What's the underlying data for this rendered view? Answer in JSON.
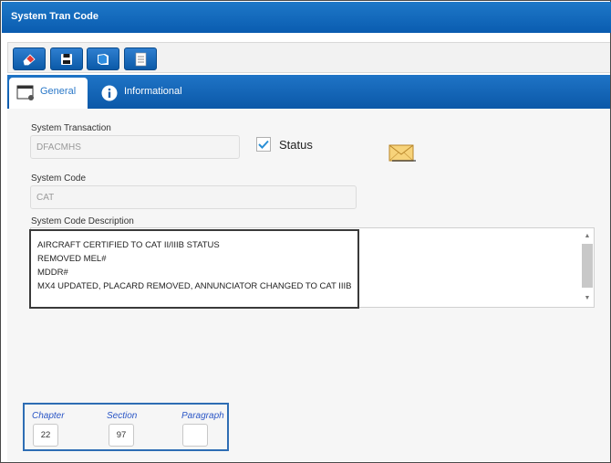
{
  "window": {
    "title": "System Tran Code"
  },
  "toolbar": {
    "buttons": [
      {
        "icon": "eraser-icon"
      },
      {
        "icon": "save-icon"
      },
      {
        "icon": "book-icon"
      },
      {
        "icon": "document-icon"
      }
    ]
  },
  "tabs": [
    {
      "label": "General",
      "icon": "window-icon",
      "active": true
    },
    {
      "label": "Informational",
      "icon": "info-icon",
      "active": false
    }
  ],
  "form": {
    "system_transaction_label": "System Transaction",
    "system_transaction_value": "DFACMHS",
    "status_label": "Status",
    "status_checked": true,
    "system_code_label": "System Code",
    "system_code_value": "CAT",
    "description_label": "System Code Description",
    "description_value": "AIRCRAFT CERTIFIED TO CAT II/IIIB STATUS\nREMOVED MEL#\nMDDR#\nMX4 UPDATED, PLACARD REMOVED, ANNUNCIATOR CHANGED TO CAT IIIB"
  },
  "reference": {
    "chapter_label": "Chapter",
    "chapter_value": "22",
    "section_label": "Section",
    "section_value": "97",
    "paragraph_label": "Paragraph",
    "paragraph_value": ""
  },
  "colors": {
    "header_blue": "#0a5cb0",
    "tab_active_text": "#2a78c8",
    "highlight_border": "#2e6db4",
    "chapter_label_color": "#2a56c6"
  }
}
